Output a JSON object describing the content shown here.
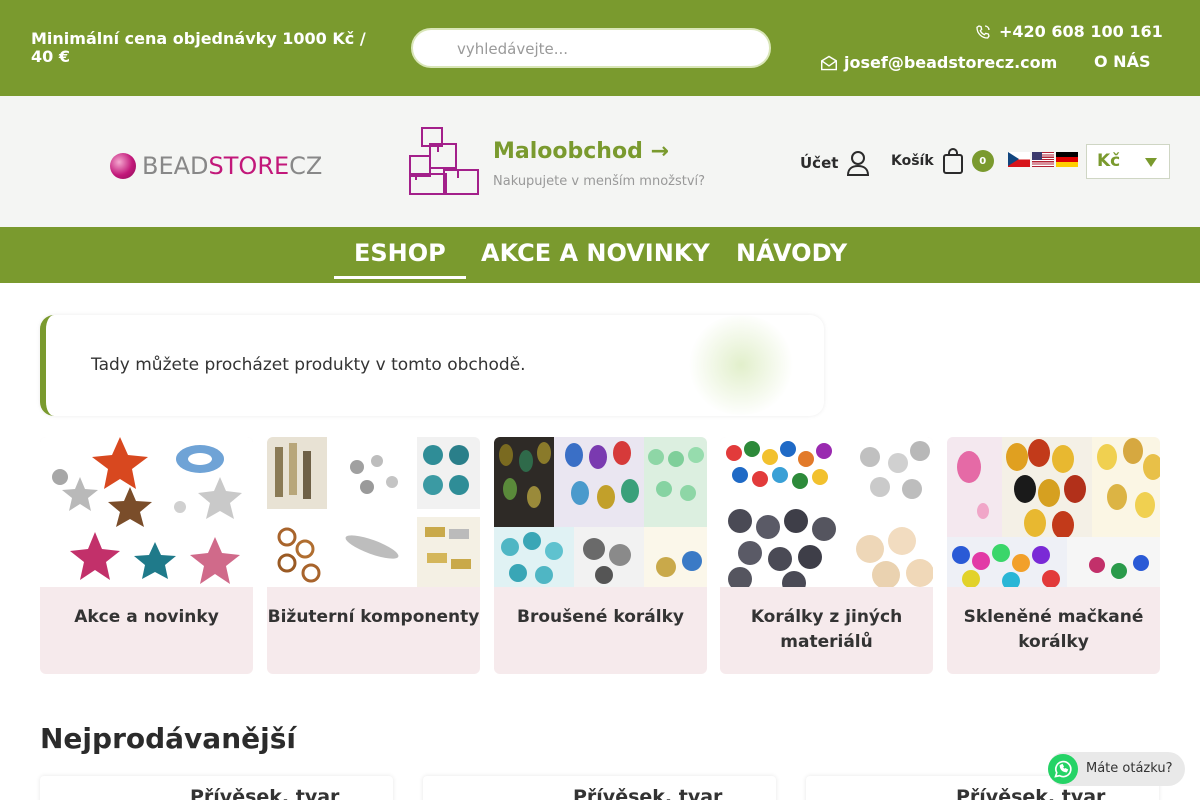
{
  "topbar": {
    "min_order": "Minimální cena objednávky 1000 Kč / 40 €",
    "search_placeholder": "vyhledávejte...",
    "phone": "+420 608 100 161",
    "email": "josef@beadstorecz.com",
    "about": "O NÁS"
  },
  "header": {
    "logo": {
      "part1": "BEAD",
      "part2": "STORE",
      "part3": "CZ"
    },
    "retail_title": "Maloobchod →",
    "retail_sub": "Nakupujete v menším množství?",
    "account_label": "Účet",
    "cart_label": "Košík",
    "cart_count": "0",
    "currency": "Kč"
  },
  "nav": {
    "items": [
      {
        "label": "ESHOP"
      },
      {
        "label": "AKCE A NOVINKY"
      },
      {
        "label": "NÁVODY"
      }
    ]
  },
  "info": {
    "text": "Tady můžete procházet produkty v tomto obchodě."
  },
  "categories": [
    {
      "label": "Akce a novinky"
    },
    {
      "label": "Bižuterní komponenty"
    },
    {
      "label": "Broušené korálky"
    },
    {
      "label": "Korálky z jiných materiálů"
    },
    {
      "label": "Skleněné mačkané korálky"
    }
  ],
  "bestsellers": {
    "title": "Nejprodávanější",
    "products": [
      {
        "name": "Přívěsek, tvar"
      },
      {
        "name": "Přívěsek, tvar"
      },
      {
        "name": "Přívěsek, tvar"
      }
    ]
  },
  "whatsapp": {
    "label": "Máte otázku?"
  },
  "colors": {
    "brand_green": "#7a9a2e",
    "logo_pink": "#c2187a",
    "category_bg": "#f6eaec"
  }
}
